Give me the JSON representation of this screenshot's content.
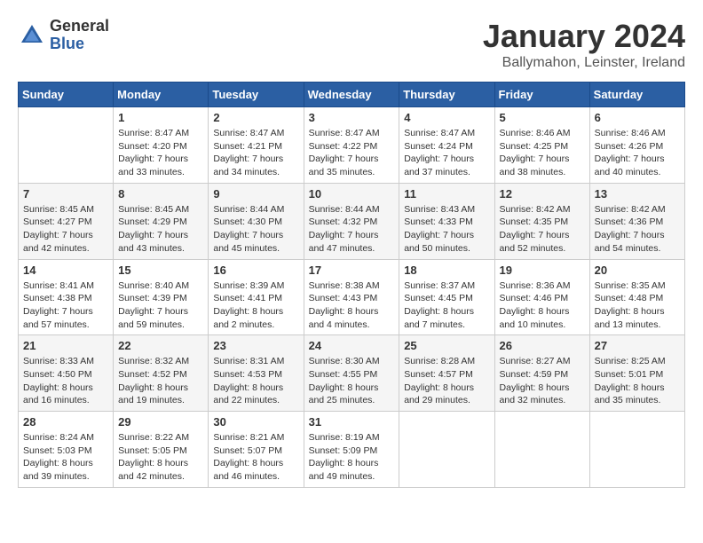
{
  "logo": {
    "general": "General",
    "blue": "Blue"
  },
  "header": {
    "month": "January 2024",
    "location": "Ballymahon, Leinster, Ireland"
  },
  "days_of_week": [
    "Sunday",
    "Monday",
    "Tuesday",
    "Wednesday",
    "Thursday",
    "Friday",
    "Saturday"
  ],
  "weeks": [
    [
      {
        "day": "",
        "sunrise": "",
        "sunset": "",
        "daylight": ""
      },
      {
        "day": "1",
        "sunrise": "Sunrise: 8:47 AM",
        "sunset": "Sunset: 4:20 PM",
        "daylight": "Daylight: 7 hours and 33 minutes."
      },
      {
        "day": "2",
        "sunrise": "Sunrise: 8:47 AM",
        "sunset": "Sunset: 4:21 PM",
        "daylight": "Daylight: 7 hours and 34 minutes."
      },
      {
        "day": "3",
        "sunrise": "Sunrise: 8:47 AM",
        "sunset": "Sunset: 4:22 PM",
        "daylight": "Daylight: 7 hours and 35 minutes."
      },
      {
        "day": "4",
        "sunrise": "Sunrise: 8:47 AM",
        "sunset": "Sunset: 4:24 PM",
        "daylight": "Daylight: 7 hours and 37 minutes."
      },
      {
        "day": "5",
        "sunrise": "Sunrise: 8:46 AM",
        "sunset": "Sunset: 4:25 PM",
        "daylight": "Daylight: 7 hours and 38 minutes."
      },
      {
        "day": "6",
        "sunrise": "Sunrise: 8:46 AM",
        "sunset": "Sunset: 4:26 PM",
        "daylight": "Daylight: 7 hours and 40 minutes."
      }
    ],
    [
      {
        "day": "7",
        "sunrise": "Sunrise: 8:45 AM",
        "sunset": "Sunset: 4:27 PM",
        "daylight": "Daylight: 7 hours and 42 minutes."
      },
      {
        "day": "8",
        "sunrise": "Sunrise: 8:45 AM",
        "sunset": "Sunset: 4:29 PM",
        "daylight": "Daylight: 7 hours and 43 minutes."
      },
      {
        "day": "9",
        "sunrise": "Sunrise: 8:44 AM",
        "sunset": "Sunset: 4:30 PM",
        "daylight": "Daylight: 7 hours and 45 minutes."
      },
      {
        "day": "10",
        "sunrise": "Sunrise: 8:44 AM",
        "sunset": "Sunset: 4:32 PM",
        "daylight": "Daylight: 7 hours and 47 minutes."
      },
      {
        "day": "11",
        "sunrise": "Sunrise: 8:43 AM",
        "sunset": "Sunset: 4:33 PM",
        "daylight": "Daylight: 7 hours and 50 minutes."
      },
      {
        "day": "12",
        "sunrise": "Sunrise: 8:42 AM",
        "sunset": "Sunset: 4:35 PM",
        "daylight": "Daylight: 7 hours and 52 minutes."
      },
      {
        "day": "13",
        "sunrise": "Sunrise: 8:42 AM",
        "sunset": "Sunset: 4:36 PM",
        "daylight": "Daylight: 7 hours and 54 minutes."
      }
    ],
    [
      {
        "day": "14",
        "sunrise": "Sunrise: 8:41 AM",
        "sunset": "Sunset: 4:38 PM",
        "daylight": "Daylight: 7 hours and 57 minutes."
      },
      {
        "day": "15",
        "sunrise": "Sunrise: 8:40 AM",
        "sunset": "Sunset: 4:39 PM",
        "daylight": "Daylight: 7 hours and 59 minutes."
      },
      {
        "day": "16",
        "sunrise": "Sunrise: 8:39 AM",
        "sunset": "Sunset: 4:41 PM",
        "daylight": "Daylight: 8 hours and 2 minutes."
      },
      {
        "day": "17",
        "sunrise": "Sunrise: 8:38 AM",
        "sunset": "Sunset: 4:43 PM",
        "daylight": "Daylight: 8 hours and 4 minutes."
      },
      {
        "day": "18",
        "sunrise": "Sunrise: 8:37 AM",
        "sunset": "Sunset: 4:45 PM",
        "daylight": "Daylight: 8 hours and 7 minutes."
      },
      {
        "day": "19",
        "sunrise": "Sunrise: 8:36 AM",
        "sunset": "Sunset: 4:46 PM",
        "daylight": "Daylight: 8 hours and 10 minutes."
      },
      {
        "day": "20",
        "sunrise": "Sunrise: 8:35 AM",
        "sunset": "Sunset: 4:48 PM",
        "daylight": "Daylight: 8 hours and 13 minutes."
      }
    ],
    [
      {
        "day": "21",
        "sunrise": "Sunrise: 8:33 AM",
        "sunset": "Sunset: 4:50 PM",
        "daylight": "Daylight: 8 hours and 16 minutes."
      },
      {
        "day": "22",
        "sunrise": "Sunrise: 8:32 AM",
        "sunset": "Sunset: 4:52 PM",
        "daylight": "Daylight: 8 hours and 19 minutes."
      },
      {
        "day": "23",
        "sunrise": "Sunrise: 8:31 AM",
        "sunset": "Sunset: 4:53 PM",
        "daylight": "Daylight: 8 hours and 22 minutes."
      },
      {
        "day": "24",
        "sunrise": "Sunrise: 8:30 AM",
        "sunset": "Sunset: 4:55 PM",
        "daylight": "Daylight: 8 hours and 25 minutes."
      },
      {
        "day": "25",
        "sunrise": "Sunrise: 8:28 AM",
        "sunset": "Sunset: 4:57 PM",
        "daylight": "Daylight: 8 hours and 29 minutes."
      },
      {
        "day": "26",
        "sunrise": "Sunrise: 8:27 AM",
        "sunset": "Sunset: 4:59 PM",
        "daylight": "Daylight: 8 hours and 32 minutes."
      },
      {
        "day": "27",
        "sunrise": "Sunrise: 8:25 AM",
        "sunset": "Sunset: 5:01 PM",
        "daylight": "Daylight: 8 hours and 35 minutes."
      }
    ],
    [
      {
        "day": "28",
        "sunrise": "Sunrise: 8:24 AM",
        "sunset": "Sunset: 5:03 PM",
        "daylight": "Daylight: 8 hours and 39 minutes."
      },
      {
        "day": "29",
        "sunrise": "Sunrise: 8:22 AM",
        "sunset": "Sunset: 5:05 PM",
        "daylight": "Daylight: 8 hours and 42 minutes."
      },
      {
        "day": "30",
        "sunrise": "Sunrise: 8:21 AM",
        "sunset": "Sunset: 5:07 PM",
        "daylight": "Daylight: 8 hours and 46 minutes."
      },
      {
        "day": "31",
        "sunrise": "Sunrise: 8:19 AM",
        "sunset": "Sunset: 5:09 PM",
        "daylight": "Daylight: 8 hours and 49 minutes."
      },
      {
        "day": "",
        "sunrise": "",
        "sunset": "",
        "daylight": ""
      },
      {
        "day": "",
        "sunrise": "",
        "sunset": "",
        "daylight": ""
      },
      {
        "day": "",
        "sunrise": "",
        "sunset": "",
        "daylight": ""
      }
    ]
  ]
}
